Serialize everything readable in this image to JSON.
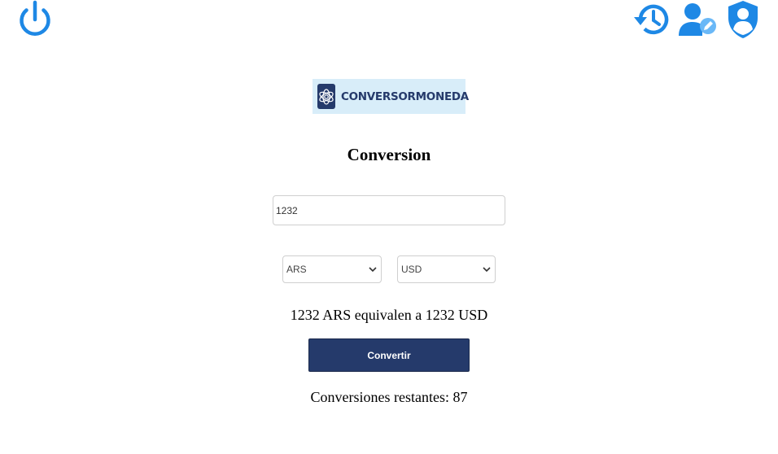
{
  "header": {
    "power_icon": "power-icon",
    "history_icon": "history-icon",
    "user_edit_icon": "user-edit-icon",
    "profile_icon": "profile-shield-icon",
    "accent_color": "#1e88e5"
  },
  "logo": {
    "text": "CONVERSORMONEDA",
    "icon": "flower-logo-icon",
    "brand_color": "#253a6b",
    "background": "#d8edf9"
  },
  "main": {
    "title": "Conversion",
    "amount_value": "1232",
    "from_currency": "ARS",
    "to_currency": "USD",
    "result_text": "1232 ARS equivalen a 1232 USD",
    "convert_label": "Convertir",
    "remaining_text": "Conversiones restantes: 87"
  }
}
